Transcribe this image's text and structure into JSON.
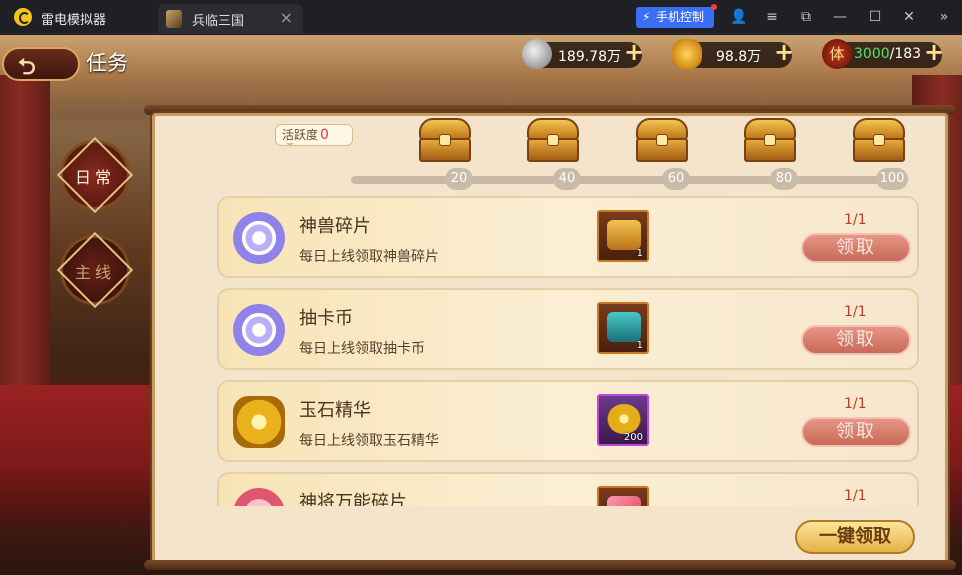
{
  "titlebar": {
    "app_name": "雷电模拟器",
    "tab_title": "兵临三国",
    "tab_close": "×",
    "phone_control": "手机控制",
    "icons": {
      "user": "👤",
      "menu": "≡",
      "restore": "⧉",
      "minimize": "—",
      "maximize": "☐",
      "close": "✕",
      "expand": "»"
    }
  },
  "header": {
    "back_icon": "⮌",
    "title": "任务"
  },
  "resources": {
    "coins": "189.78万",
    "ingots": "98.8万",
    "stamina_icon": "体",
    "stamina_current": "3000",
    "stamina_max": "/183",
    "plus": "+"
  },
  "side_tabs": {
    "daily": "日常",
    "main": "主线"
  },
  "activity": {
    "label": "活跃度",
    "value": "0"
  },
  "milestones": [
    "20",
    "40",
    "60",
    "80",
    "100"
  ],
  "tasks": [
    {
      "name": "神兽碎片",
      "desc": "每日上线领取神兽碎片",
      "reward_qty": "1",
      "progress": "1/1",
      "claim": "领取"
    },
    {
      "name": "抽卡币",
      "desc": "每日上线领取抽卡币",
      "reward_qty": "1",
      "progress": "1/1",
      "claim": "领取"
    },
    {
      "name": "玉石精华",
      "desc": "每日上线领取玉石精华",
      "reward_qty": "200",
      "progress": "1/1",
      "claim": "领取"
    },
    {
      "name": "神将万能碎片",
      "desc": "",
      "reward_qty": "",
      "progress": "1/1",
      "claim": ""
    }
  ],
  "claim_all": "一键领取",
  "colors": {
    "accent_blue": "#3a6ef6",
    "panel_bg": "#f3e4cb",
    "progress_red": "#c0392b",
    "claim_btn": "#d97b69"
  }
}
